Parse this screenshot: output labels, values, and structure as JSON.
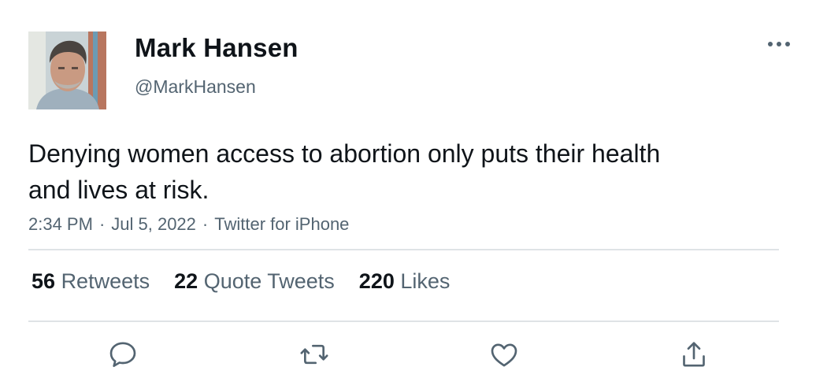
{
  "tweet": {
    "author": {
      "name": "Mark Hansen",
      "handle": "@MarkHansen",
      "avatar": "avatar-photo"
    },
    "text": "Denying women access to abortion only puts their health and lives at risk.",
    "meta": {
      "time": "2:34 PM",
      "date": "Jul 5, 2022",
      "source": "Twitter for iPhone",
      "separator": "·"
    },
    "stats": {
      "retweets": {
        "count": "56",
        "label": "Retweets"
      },
      "quote_tweets": {
        "count": "22",
        "label": "Quote Tweets"
      },
      "likes": {
        "count": "220",
        "label": "Likes"
      }
    },
    "actions": [
      {
        "icon": "reply-icon"
      },
      {
        "icon": "retweet-icon"
      },
      {
        "icon": "like-icon"
      },
      {
        "icon": "share-icon"
      }
    ],
    "menu_icon": "more-options-icon"
  },
  "colors": {
    "text_primary": "#0f1419",
    "text_secondary": "#536471",
    "divider": "#dfe3e6",
    "icon": "#536471"
  }
}
